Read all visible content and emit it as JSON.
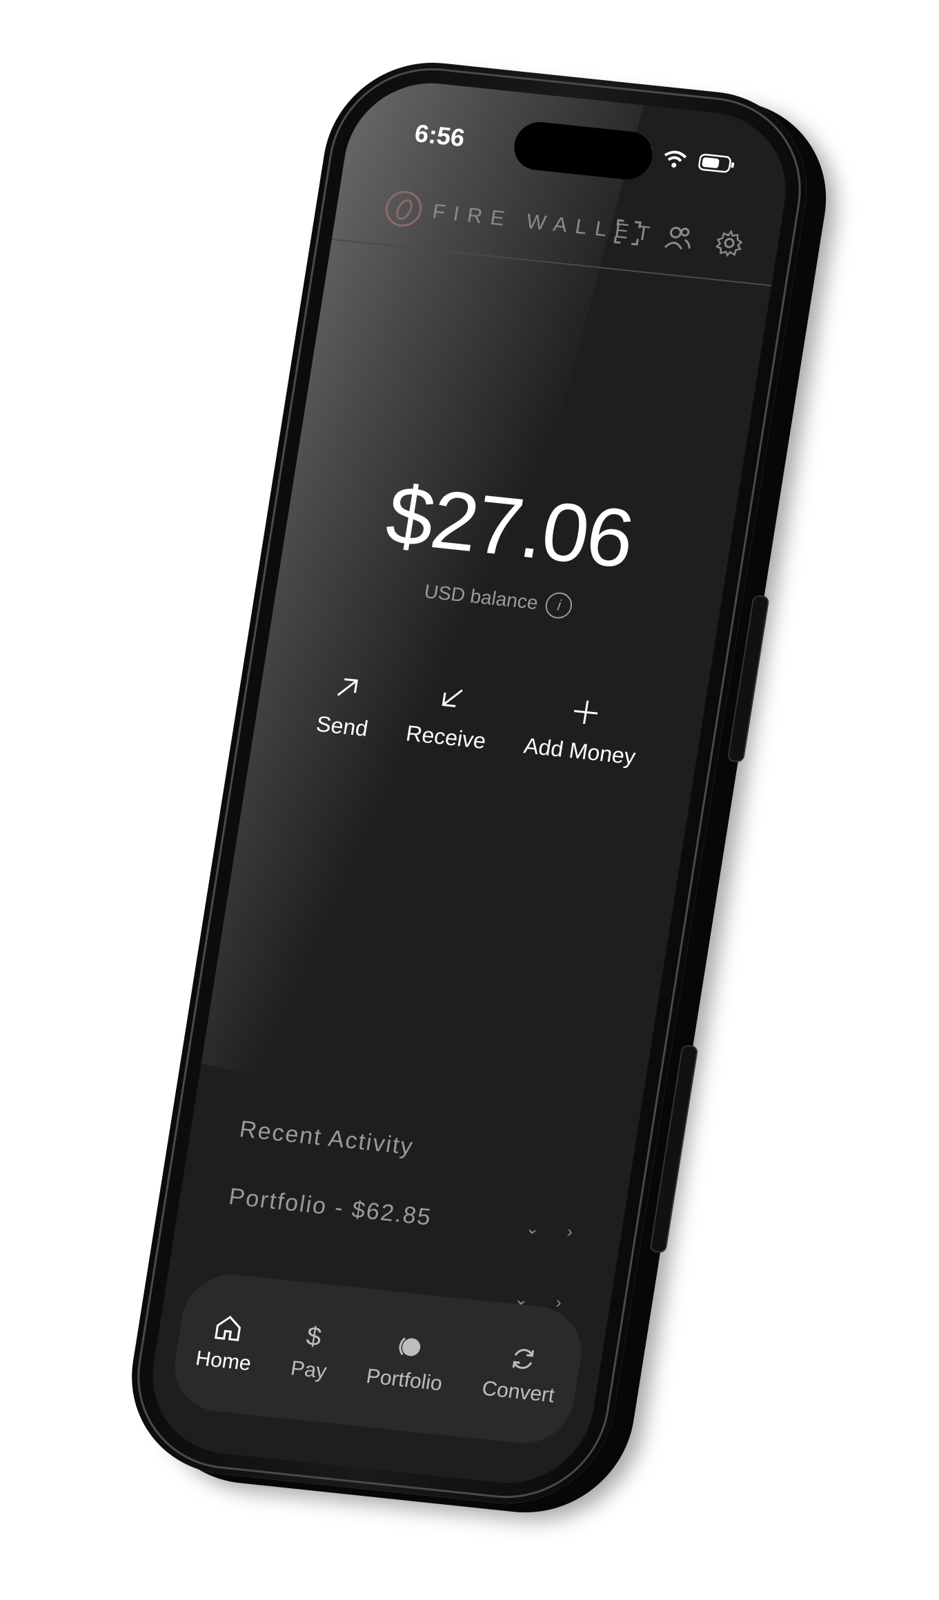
{
  "status_bar": {
    "time": "6:56"
  },
  "header": {
    "app_name": "FIRE WALLET",
    "icons": [
      "scan-icon",
      "contacts-icon",
      "gear-icon"
    ]
  },
  "balance": {
    "amount": "$27.06",
    "label": "USD balance",
    "info_icon": "i"
  },
  "actions": [
    {
      "label": "Send",
      "icon": "arrow-up-right-icon"
    },
    {
      "label": "Receive",
      "icon": "arrow-down-left-icon"
    },
    {
      "label": "Add Money",
      "icon": "plus-icon"
    }
  ],
  "activity": {
    "title": "Recent Activity",
    "portfolio_label": "Portfolio - $62.85"
  },
  "tabs": [
    {
      "label": "Home",
      "icon": "home-icon",
      "active": true
    },
    {
      "label": "Pay",
      "icon": "dollar-icon",
      "active": false
    },
    {
      "label": "Portfolio",
      "icon": "portfolio-icon",
      "active": false
    },
    {
      "label": "Convert",
      "icon": "convert-icon",
      "active": false
    }
  ],
  "colors": {
    "screen_bg": "#1e1e1e",
    "text_primary": "#ffffff",
    "text_muted": "#9a9a9a",
    "logo_accent": "#8b6a6a",
    "tabbar_bg": "#2a2a2a"
  }
}
